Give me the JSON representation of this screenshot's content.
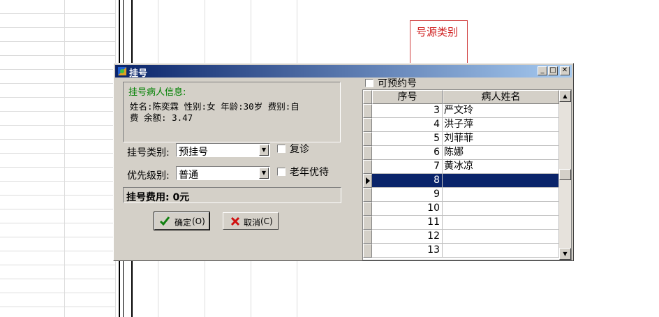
{
  "annotation": {
    "label": "号源类别",
    "color": "#d02020"
  },
  "dialog": {
    "title": "挂号",
    "patient_group": {
      "title": "挂号病人信息:",
      "line1": "姓名:陈奕霖 性别:女 年龄:30岁 费别:自",
      "line2": "费 余额: 3.47"
    },
    "reg_type": {
      "label": "挂号类别:",
      "value": "预挂号"
    },
    "revisit": {
      "label": "复诊",
      "checked": false
    },
    "priority": {
      "label": "优先级别:",
      "value": "普通"
    },
    "elderly": {
      "label": "老年优待",
      "checked": false
    },
    "fee": {
      "text": "挂号费用: 0元"
    },
    "ok_button": {
      "label": "确定",
      "shortcut": "(O)"
    },
    "cancel_button": {
      "label": "取消",
      "shortcut": "(C)"
    },
    "bookable": {
      "label": "可预约号",
      "checked": false
    },
    "grid": {
      "columns": [
        "序号",
        "病人姓名"
      ],
      "selected_row": 5,
      "rows": [
        {
          "no": "3",
          "name": "严文玲"
        },
        {
          "no": "4",
          "name": "洪子萍"
        },
        {
          "no": "5",
          "name": "刘菲菲"
        },
        {
          "no": "6",
          "name": "陈娜"
        },
        {
          "no": "7",
          "name": "黄冰凉"
        },
        {
          "no": "8",
          "name": ""
        },
        {
          "no": "9",
          "name": ""
        },
        {
          "no": "10",
          "name": ""
        },
        {
          "no": "11",
          "name": ""
        },
        {
          "no": "12",
          "name": ""
        },
        {
          "no": "13",
          "name": ""
        }
      ]
    }
  },
  "colors": {
    "title_start": "#0a246a",
    "title_end": "#a6caf0",
    "selection": "#0a246a",
    "group_title": "#008000"
  }
}
